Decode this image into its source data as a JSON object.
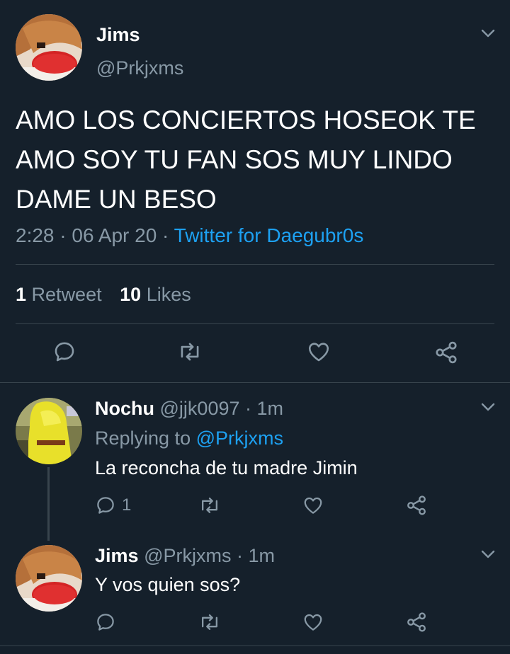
{
  "main_tweet": {
    "display_name": "Jims",
    "handle": "@Prkjxms",
    "text": "AMO LOS CONCIERTOS HOSEOK TE AMO SOY TU FAN SOS MUY LINDO DAME UN BESO",
    "time": "2:28",
    "date": "06 Apr 20",
    "separator": "·",
    "client": "Twitter for Daegubr0s",
    "retweets_count": "1",
    "retweets_label": "Retweet",
    "likes_count": "10",
    "likes_label": "Likes"
  },
  "replies": [
    {
      "display_name": "Nochu",
      "handle": "@jjk0097",
      "time": "· 1m",
      "replying_prefix": "Replying to",
      "replying_handle": "@Prkjxms",
      "text": "La reconcha de tu madre Jimin",
      "reply_count": "1"
    },
    {
      "display_name": "Jims",
      "handle": "@Prkjxms",
      "time": "· 1m",
      "text": "Y vos quien sos?"
    }
  ],
  "icons": {
    "reply": "reply-icon",
    "retweet": "retweet-icon",
    "like": "heart-icon",
    "share": "share-icon",
    "menu": "chevron-down-icon"
  },
  "colors": {
    "background": "#15202b",
    "accent": "#1da1f2",
    "muted": "#8899a6",
    "divider": "#38444d"
  }
}
